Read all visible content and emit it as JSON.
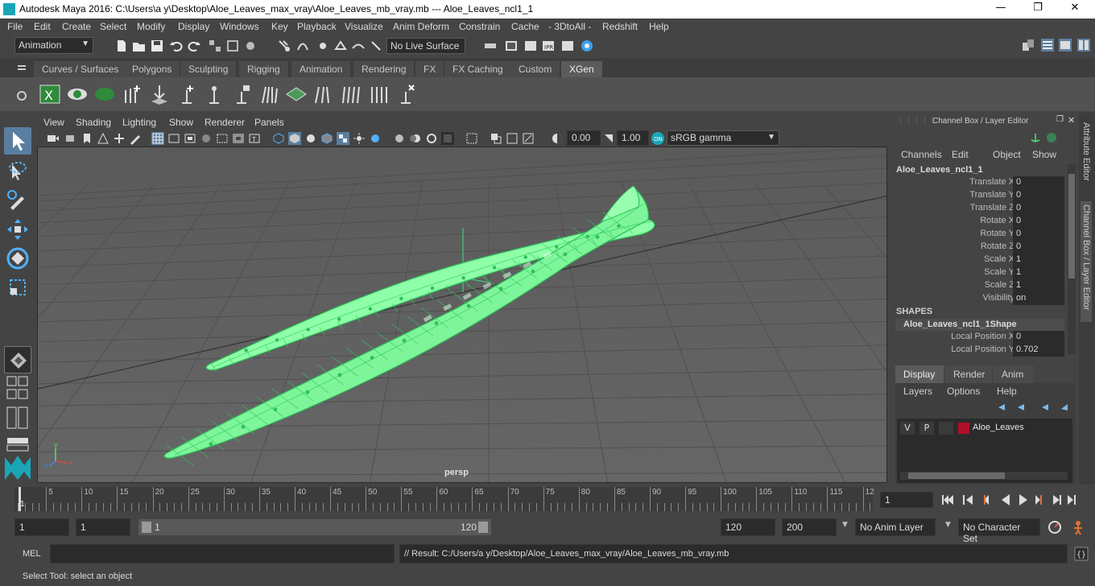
{
  "window": {
    "title": "Autodesk Maya 2016: C:\\Users\\a y\\Desktop\\Aloe_Leaves_max_vray\\Aloe_Leaves_mb_vray.mb   ---   Aloe_Leaves_ncl1_1",
    "minimize": "—",
    "maximize": "❐",
    "close": "✕"
  },
  "menubar": [
    "File",
    "Edit",
    "Create",
    "Select",
    "Modify",
    "Display",
    "Windows",
    "Key",
    "Playback",
    "Visualize",
    "Anim Deform",
    "Constrain",
    "Cache",
    "- 3DtoAll -",
    "Redshift",
    "Help"
  ],
  "statusline": {
    "menuset": "Animation",
    "live_surface": "No Live Surface"
  },
  "shelf_tabs": [
    "Curves / Surfaces",
    "Polygons",
    "Sculpting",
    "Rigging",
    "Animation",
    "Rendering",
    "FX",
    "FX Caching",
    "Custom",
    "XGen"
  ],
  "active_shelf_tab": "XGen",
  "panel_menu": [
    "View",
    "Shading",
    "Lighting",
    "Show",
    "Renderer",
    "Panels"
  ],
  "panel_toolbar": {
    "exposure": "0.00",
    "gamma": "1.00",
    "color_space": "sRGB gamma"
  },
  "viewport": {
    "camera_label": "persp",
    "mesh_color": "#7dff9a",
    "wire_color": "#3fd36a"
  },
  "channel_box": {
    "title": "Channel Box / Layer Editor",
    "menu": [
      "Channels",
      "Edit",
      "Object",
      "Show"
    ],
    "object_name": "Aloe_Leaves_ncl1_1",
    "channels": [
      {
        "label": "Translate X",
        "value": "0"
      },
      {
        "label": "Translate Y",
        "value": "0"
      },
      {
        "label": "Translate Z",
        "value": "0"
      },
      {
        "label": "Rotate X",
        "value": "0"
      },
      {
        "label": "Rotate Y",
        "value": "0"
      },
      {
        "label": "Rotate Z",
        "value": "0"
      },
      {
        "label": "Scale X",
        "value": "1"
      },
      {
        "label": "Scale Y",
        "value": "1"
      },
      {
        "label": "Scale Z",
        "value": "1"
      },
      {
        "label": "Visibility",
        "value": "on"
      }
    ],
    "shapes_header": "SHAPES",
    "shape_name": "Aloe_Leaves_ncl1_1Shape",
    "shape_channels": [
      {
        "label": "Local Position X",
        "value": "0"
      },
      {
        "label": "Local Position Y",
        "value": "0.702"
      }
    ]
  },
  "layer_editor": {
    "tabs": [
      "Display",
      "Render",
      "Anim"
    ],
    "menu": [
      "Layers",
      "Options",
      "Help"
    ],
    "layer": {
      "v": "V",
      "p": "P",
      "name": "Aloe_Leaves",
      "color": "#b0102a"
    }
  },
  "side_tabs": [
    "Attribute Editor",
    "Channel Box / Layer Editor"
  ],
  "timeline": {
    "ticks": [
      "5",
      "10",
      "15",
      "20",
      "25",
      "30",
      "35",
      "40",
      "45",
      "50",
      "55",
      "60",
      "65",
      "70",
      "75",
      "80",
      "85",
      "90",
      "95",
      "100",
      "105",
      "110",
      "115",
      "12"
    ],
    "start_mark": "1",
    "current_frame": "1"
  },
  "range": {
    "start": "1",
    "anim_start": "1",
    "slider_min": "1",
    "slider_max": "120",
    "end": "120",
    "anim_end": "200",
    "anim_layer": "No Anim Layer",
    "character_set": "No Character Set"
  },
  "command": {
    "lang": "MEL",
    "result": "// Result: C:/Users/a y/Desktop/Aloe_Leaves_max_vray/Aloe_Leaves_mb_vray.mb"
  },
  "help_line": "Select Tool: select an object"
}
